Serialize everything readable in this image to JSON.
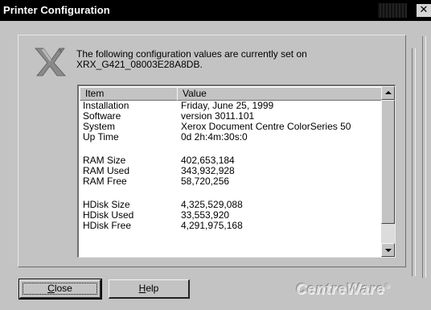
{
  "window": {
    "title": "Printer Configuration",
    "close_glyph": "✕"
  },
  "intro": {
    "line1": "The following configuration values are currently set on",
    "line2": "XRX_G421_08003E28A8DB."
  },
  "logo": {
    "icon": "xerox-x-logo-icon"
  },
  "table": {
    "headers": {
      "item": "Item",
      "value": "Value"
    },
    "rows": [
      {
        "item": "Installation",
        "value": "Friday, June 25, 1999"
      },
      {
        "item": "Software",
        "value": "version 3011.101"
      },
      {
        "item": "System",
        "value": "Xerox Document Centre ColorSeries 50"
      },
      {
        "item": "Up Time",
        "value": "0d 2h:4m:30s:0"
      },
      {
        "item": "",
        "value": ""
      },
      {
        "item": "RAM Size",
        "value": "402,653,184"
      },
      {
        "item": "RAM Used",
        "value": "343,932,928"
      },
      {
        "item": "RAM Free",
        "value": "58,720,256"
      },
      {
        "item": "",
        "value": ""
      },
      {
        "item": "HDisk Size",
        "value": "4,325,529,088"
      },
      {
        "item": "HDisk Used",
        "value": "33,553,920"
      },
      {
        "item": "HDisk Free",
        "value": "4,291,975,168"
      }
    ]
  },
  "buttons": {
    "close_prefix": "",
    "close_key": "C",
    "close_rest": "lose",
    "help_key": "H",
    "help_rest": "elp"
  },
  "brand": {
    "name": "CentreWare",
    "mark": "®"
  },
  "colors": {
    "titlebar": "#000000",
    "dialog": "#c3c3c3",
    "list_bg": "#ffffff"
  }
}
